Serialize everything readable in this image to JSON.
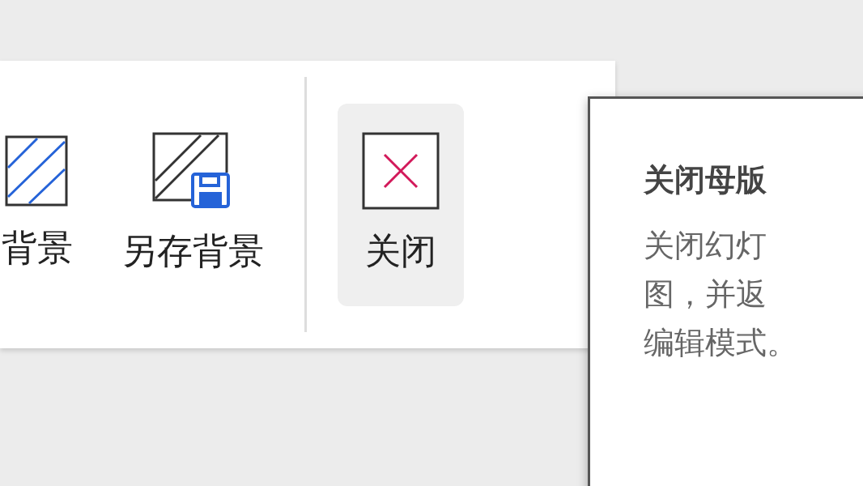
{
  "toolbar": {
    "items": [
      {
        "kind": "background",
        "label": "背景",
        "hovered": false
      },
      {
        "kind": "save-background",
        "label": "另存背景",
        "hovered": false
      },
      {
        "kind": "divider"
      },
      {
        "kind": "close",
        "label": "关闭",
        "hovered": true
      }
    ]
  },
  "tooltip": {
    "title": "关闭母版",
    "lines": [
      "关闭幻灯",
      "图，并返",
      "编辑模式。"
    ]
  }
}
